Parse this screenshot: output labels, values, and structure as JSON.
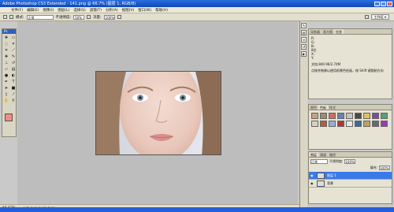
{
  "window": {
    "title": "Adobe Photoshop CS3 Extended - 141.png @ 66.7% (图层 1, RGB/8)"
  },
  "menu": [
    "文件(F)",
    "编辑(E)",
    "图像(I)",
    "图层(L)",
    "选择(S)",
    "滤镜(T)",
    "分析(A)",
    "视图(V)",
    "窗口(W)",
    "帮助(H)"
  ],
  "options": {
    "mode_label": "模式:",
    "mode_value": "正常",
    "opacity_label": "不透明度:",
    "opacity_value": "50%",
    "flow_label": "流量:",
    "flow_value": "100%",
    "workspace_label": "工作区 ▾"
  },
  "toolbox": {
    "title": "Ps"
  },
  "status": {
    "zoom": "66.67%",
    "doc": "文档:840.9K/2.74M"
  },
  "info_panel": {
    "tabs": [
      "导航器",
      "直方图",
      "信息"
    ],
    "rows": [
      {
        "k": "R:",
        "v": ""
      },
      {
        "k": "G:",
        "v": ""
      },
      {
        "k": "B:",
        "v": ""
      },
      {
        "k": "8位",
        "v": ""
      },
      {
        "k": "X:",
        "v": ""
      },
      {
        "k": "Y:",
        "v": ""
      }
    ],
    "doc": "文档:840.9K/2.74M",
    "hint": "点按并拖移以使用前景色绘画，按 Shift 键限制方向"
  },
  "swatches_panel": {
    "tabs": [
      "颜色",
      "色板",
      "样式"
    ],
    "colors": [
      "#c9a27a",
      "#9e8b6a",
      "#d16b5e",
      "#6b7fb8",
      "#c4c4c4",
      "#4a4a4a",
      "#e0c05a",
      "#7a4c9b",
      "#5e9e7a",
      "#d8d0c0",
      "#b85c3a",
      "#8fb0d8",
      "#aa3a3a",
      "#e8e8e8",
      "#3a6a9a",
      "#c0a060",
      "#6a6a6a",
      "#9a3ab8"
    ]
  },
  "layers_panel": {
    "tabs": [
      "图层",
      "通道",
      "路径"
    ],
    "mode": "正常",
    "opacity_label": "不透明度:",
    "opacity_value": "100%",
    "fill_label": "填充:",
    "fill_value": "100%",
    "layers": [
      {
        "name": "图层 1",
        "selected": true
      },
      {
        "name": "背景",
        "selected": false
      }
    ]
  }
}
